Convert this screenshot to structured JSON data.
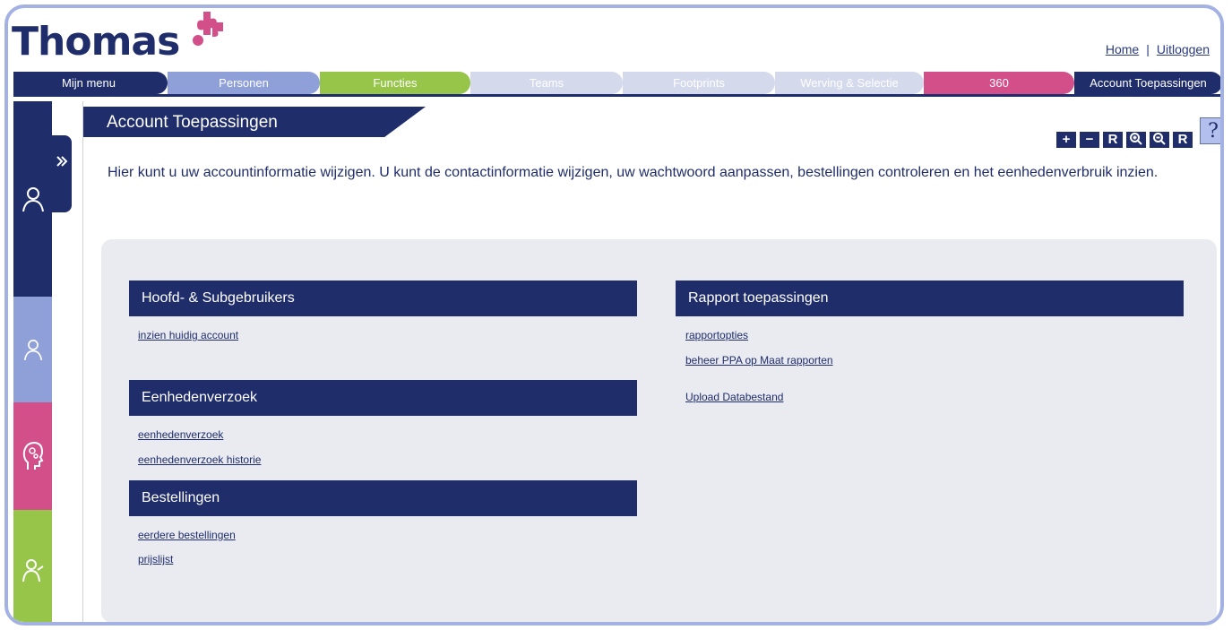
{
  "header": {
    "logo_text": "Thomas",
    "home_link": "Home",
    "separator": "|",
    "logout_link": "Uitloggen"
  },
  "nav": {
    "tabs": [
      {
        "label": "Mijn menu",
        "color": "#1f2d6b"
      },
      {
        "label": "Personen",
        "color": "#8fa0d8"
      },
      {
        "label": "Functies",
        "color": "#96c54a"
      },
      {
        "label": "Teams",
        "color": "#d4d9ec"
      },
      {
        "label": "Footprints",
        "color": "#d4d9ec"
      },
      {
        "label": "Werving & Selectie",
        "color": "#d4d9ec"
      },
      {
        "label": "360",
        "color": "#d24f8a"
      },
      {
        "label": "Account Toepassingen",
        "color": "#1f2d6b"
      }
    ]
  },
  "sidebar": {
    "items": [
      {
        "icon": "person-icon",
        "color": "#1f2d6b"
      },
      {
        "icon": "person-icon",
        "color": "#8fa0d8"
      },
      {
        "icon": "head-gears-icon",
        "color": "#d24f8a"
      },
      {
        "icon": "group-icon",
        "color": "#96c54a"
      }
    ],
    "toggle_icon": "double-chevron-right-icon"
  },
  "page": {
    "title": "Account Toepassingen",
    "intro": "Hier kunt u uw accountinformatie wijzigen. U kunt de contactinformatie wijzigen, uw wachtwoord aanpassen, bestellingen controleren en het eenhedenverbruik inzien.",
    "tools": [
      "+",
      "−",
      "R",
      "⊕",
      "⊖",
      "R"
    ],
    "help_label": "?"
  },
  "sections": {
    "hoofd": {
      "title": "Hoofd- & Subgebruikers",
      "links": [
        "inzien huidig account"
      ]
    },
    "eenheden": {
      "title": "Eenhedenverzoek",
      "links": [
        "eenhedenverzoek",
        "eenhedenverzoek historie"
      ]
    },
    "bestellingen": {
      "title": "Bestellingen",
      "links": [
        "eerdere bestellingen",
        "prijslijst"
      ]
    },
    "rapport": {
      "title": "Rapport toepassingen",
      "links": [
        "rapportopties",
        "beheer PPA op Maat rapporten",
        "Upload Databestand"
      ]
    }
  },
  "colors": {
    "navy": "#1f2d6b",
    "frame": "#a4b2e3",
    "panel": "#e9ebf1"
  }
}
